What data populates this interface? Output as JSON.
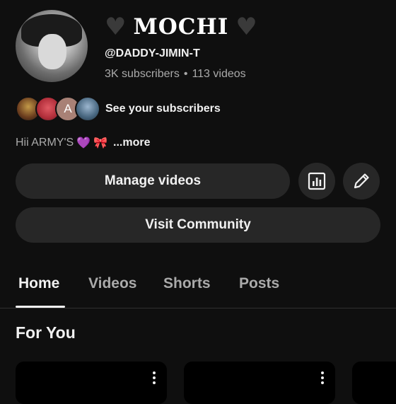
{
  "channel": {
    "name": "MOCHI",
    "name_prefix_icon": "black-heart-icon",
    "name_suffix_icon": "black-heart-icon",
    "handle": "@DADDY-JIMIN-T",
    "subscribers": "3K subscribers",
    "separator": "•",
    "videos": "113 videos",
    "avatar_icon": "channel-avatar"
  },
  "subscribers_row": {
    "label": "See your subscribers",
    "avatar_letter": "A"
  },
  "description": {
    "text": "Hii ARMY'S",
    "emoji1": "💜",
    "emoji2": "🎀",
    "more": "...more"
  },
  "actions": {
    "manage_videos": "Manage videos",
    "analytics_icon": "analytics-icon",
    "edit_icon": "pencil-icon",
    "visit_community": "Visit Community"
  },
  "tabs": [
    {
      "label": "Home",
      "active": true
    },
    {
      "label": "Videos",
      "active": false
    },
    {
      "label": "Shorts",
      "active": false
    },
    {
      "label": "Posts",
      "active": false
    }
  ],
  "section": {
    "title": "For You"
  },
  "colors": {
    "background": "#0f0f0f",
    "button": "#272727",
    "text_primary": "#f1f1f1",
    "text_secondary": "#aaaaaa"
  }
}
